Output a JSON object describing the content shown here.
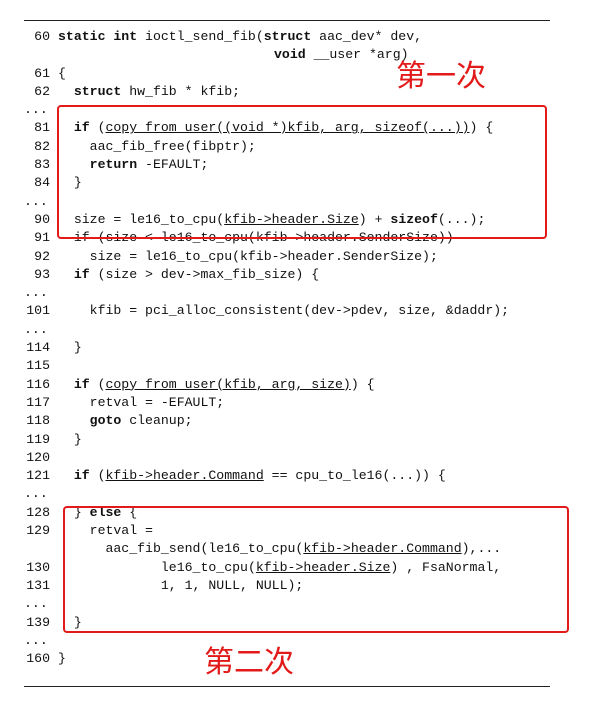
{
  "annotations": {
    "first": "第一次",
    "second": "第二次"
  },
  "code": {
    "l60": "60",
    "l60_kw1": "static int",
    "l60_a": " ioctl_send_fib(",
    "l60_kw2": "struct",
    "l60_b": " aac_dev* dev,",
    "l60c_kw": "void",
    "l60c_b": " __user *arg)",
    "l61": "61",
    "l61_t": "{",
    "l62": "62",
    "l62_kw": "struct",
    "l62_t": " hw_fib * kfib;",
    "dots": "...",
    "l81": "81",
    "l81_kw1": "if",
    "l81_u": "copy_from_user((void *)kfib, arg, sizeof(...))",
    "l81_t": ") {",
    "l82": "82",
    "l82_t": "aac_fib_free(fibptr);",
    "l83": "83",
    "l83_kw": "return",
    "l83_t": " -EFAULT;",
    "l84": "84",
    "l84_t": "}",
    "l90": "90",
    "l90_a": "size = le16_to_cpu(",
    "l90_u": "kfib->header.Size",
    "l90_b": ") + ",
    "l90_kw": "sizeof",
    "l90_c": "(...);",
    "l91": "91",
    "l91_t": "if (size < le16_to_cpu(kfib->header.SenderSize))",
    "l92": "92",
    "l92_t": "size = le16_to_cpu(kfib->header.SenderSize);",
    "l93": "93",
    "l93_kw": "if",
    "l93_t": " (size > dev->max_fib_size) {",
    "l101": "101",
    "l101_t": "kfib = pci_alloc_consistent(dev->pdev, size, &daddr);",
    "l114": "114",
    "l114_t": "}",
    "l115": "115",
    "l116": "116",
    "l116_kw": "if",
    "l116_u": "copy_from_user(kfib, arg, size)",
    "l116_t": ") {",
    "l117": "117",
    "l117_t": "retval = -EFAULT;",
    "l118": "118",
    "l118_kw": "goto",
    "l118_t": " cleanup;",
    "l119": "119",
    "l119_t": "}",
    "l120": "120",
    "l121": "121",
    "l121_kw": "if",
    "l121_u": "kfib->header.Command",
    "l121_t": " == cpu_to_le16(...)) {",
    "l128": "128",
    "l128_a": "} ",
    "l128_kw": "else",
    "l128_b": " {",
    "l129": "129",
    "l129_t": "retval =",
    "l129b_a": "aac_fib_send(le16_to_cpu(",
    "l129b_u": "kfib->header.Command",
    "l129b_b": "),...",
    "l130": "130",
    "l130_a": "le16_to_cpu(",
    "l130_u": "kfib->header.Size",
    "l130_b": ") , FsaNormal,",
    "l131": "131",
    "l131_t": "1, 1, NULL, NULL);",
    "l139": "139",
    "l139_t": "}",
    "l160": "160",
    "l160_t": "}"
  }
}
